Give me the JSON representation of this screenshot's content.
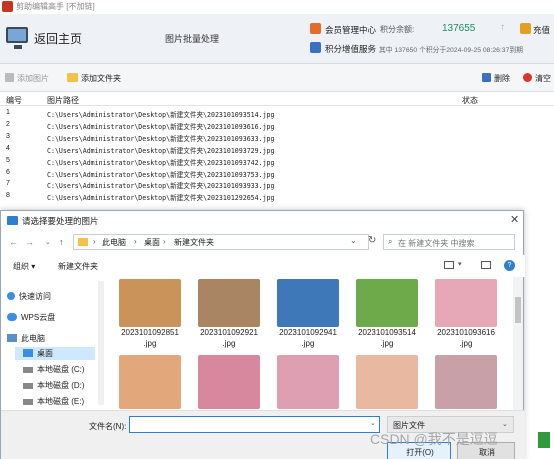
{
  "window": {
    "title": "剪助编辑高手 [不加链]"
  },
  "header": {
    "back_label": "返回主页",
    "page_title": "图片批量处理",
    "member_label": "会员管理中心",
    "points_label": "积分余额:",
    "points_value": "137655",
    "recharge_label": "充值",
    "vas_label": "积分增值服务",
    "vas_info": "其中 137650 个积分于2024-09-25 08:26:37到期"
  },
  "toolbar": {
    "add_images_label": "添加图片",
    "add_folder_label": "添加文件夹",
    "delete_label": "删除",
    "clear_label": "清空"
  },
  "table": {
    "columns": [
      "编号",
      "图片路径",
      "状态"
    ],
    "rows": [
      {
        "no": "1",
        "path": "C:\\Users\\Administrator\\Desktop\\新建文件夹\\2023101093514.jpg"
      },
      {
        "no": "2",
        "path": "C:\\Users\\Administrator\\Desktop\\新建文件夹\\2023101093616.jpg"
      },
      {
        "no": "3",
        "path": "C:\\Users\\Administrator\\Desktop\\新建文件夹\\2023101093633.jpg"
      },
      {
        "no": "4",
        "path": "C:\\Users\\Administrator\\Desktop\\新建文件夹\\2023101093729.jpg"
      },
      {
        "no": "5",
        "path": "C:\\Users\\Administrator\\Desktop\\新建文件夹\\2023101093742.jpg"
      },
      {
        "no": "6",
        "path": "C:\\Users\\Administrator\\Desktop\\新建文件夹\\2023101093753.jpg"
      },
      {
        "no": "7",
        "path": "C:\\Users\\Administrator\\Desktop\\新建文件夹\\2023101093933.jpg"
      },
      {
        "no": "8",
        "path": "C:\\Users\\Administrator\\Desktop\\新建文件夹\\2023101292654.jpg"
      }
    ]
  },
  "dialog": {
    "title": "请选择要处理的图片",
    "close": "✕",
    "address": {
      "this_pc": "此电脑",
      "desktop": "桌面",
      "folder": "新建文件夹"
    },
    "search_placeholder": "在 新建文件夹 中搜索",
    "organize_label": "组织 ▾",
    "new_folder_label": "新建文件夹",
    "nav": {
      "quick_access": "快速访问",
      "wps_cloud": "WPS云盘",
      "this_pc": "此电脑",
      "desktop": "桌面",
      "disk_c": "本地磁盘 (C:)",
      "disk_d": "本地磁盘 (D:)",
      "disk_e": "本地磁盘 (E:)"
    },
    "files_row1": [
      {
        "name": "20231010928\n51.jpg",
        "l1": "2023101092851",
        "l2": ".jpg",
        "color": "#c9935a"
      },
      {
        "name": "",
        "l1": "2023101092921",
        "l2": ".jpg",
        "color": "#a98563"
      },
      {
        "name": "",
        "l1": "2023101092941",
        "l2": ".jpg",
        "color": "#3f78b8"
      },
      {
        "name": "",
        "l1": "2023101093514",
        "l2": ".jpg",
        "color": "#6faa4a"
      },
      {
        "name": "",
        "l1": "2023101093616",
        "l2": ".jpg",
        "color": "#e6a8b6"
      }
    ],
    "files_row2": [
      {
        "l2": ".jpg",
        "color": "#e3a77c"
      },
      {
        "l2": ".jpg",
        "color": "#d8889e"
      },
      {
        "l2": ".jpg",
        "color": "#df9fb2"
      },
      {
        "l2": ".jpg",
        "color": "#e9b8a0"
      },
      {
        "l2": ".jpg",
        "color": "#c8a0a8"
      }
    ],
    "filename_label": "文件名(N):",
    "filename_value": "",
    "filetype_label": "图片文件",
    "open_label": "打开(O)",
    "cancel_label": "取消"
  },
  "watermark": "CSDN @我不是逗逗"
}
